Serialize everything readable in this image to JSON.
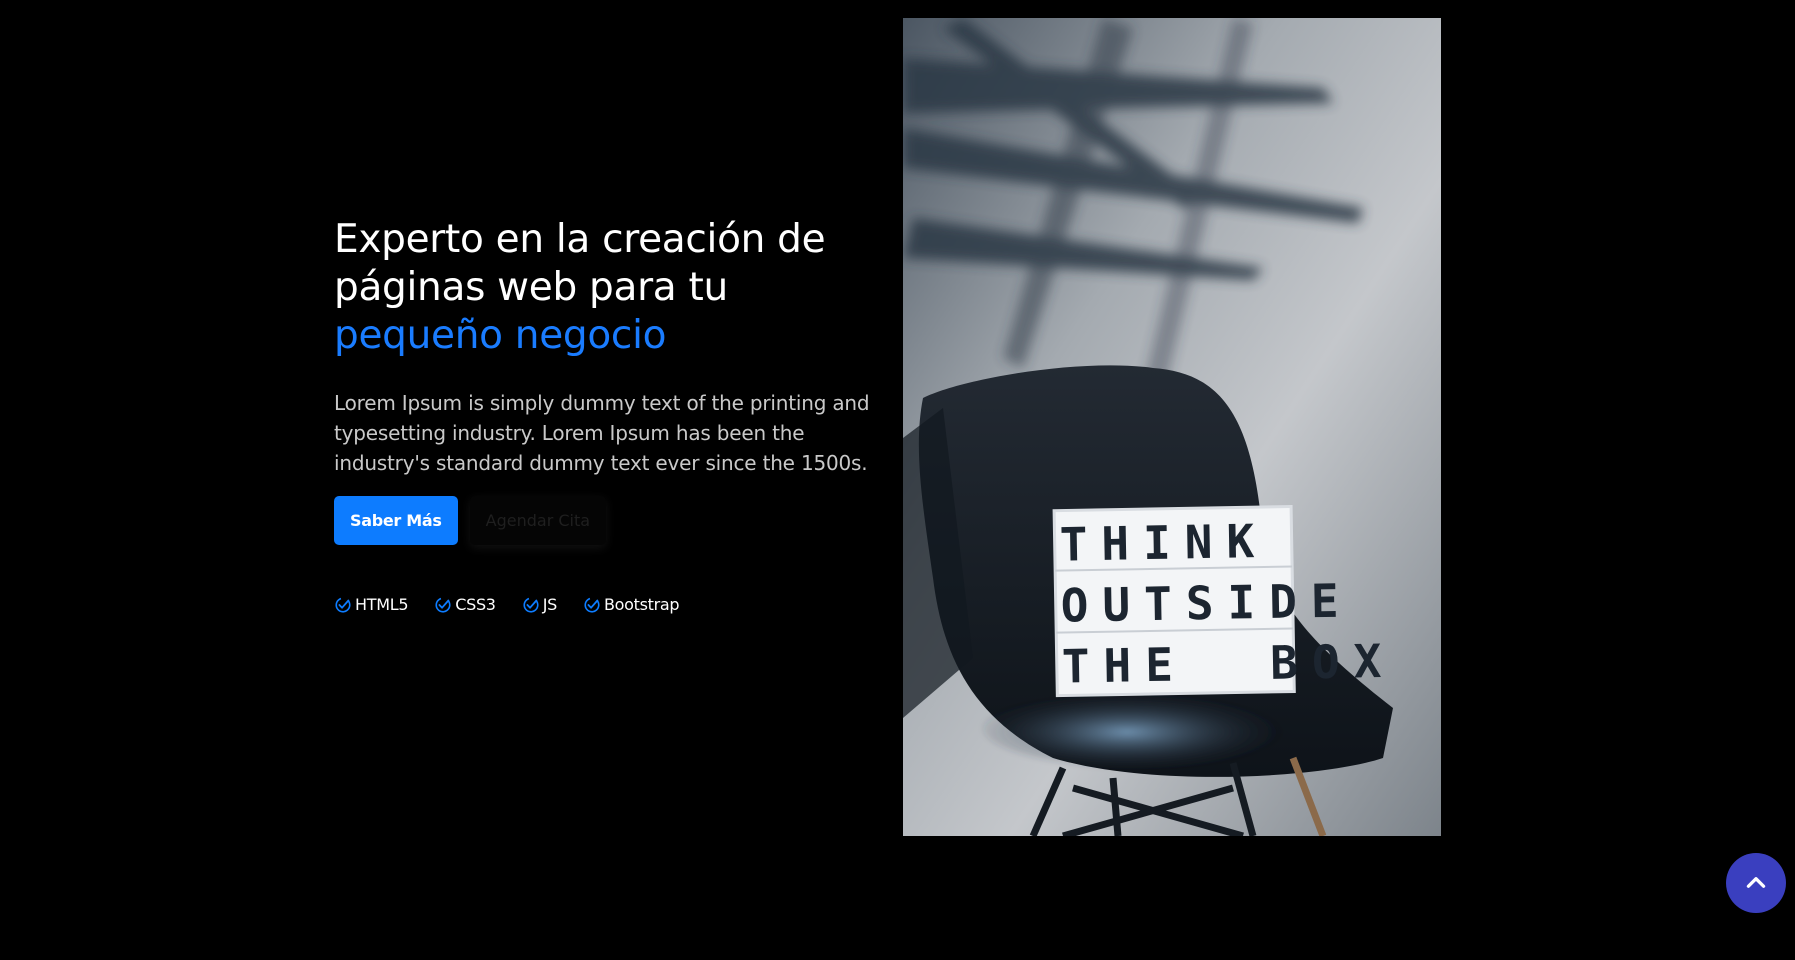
{
  "hero": {
    "headline_line1": "Experto en la creación de",
    "headline_line2": "páginas web para tu",
    "headline_accent": "pequeño negocio",
    "lead": "Lorem Ipsum is simply dummy text of the printing and typesetting industry. Lorem Ipsum has been the industry's standard dummy text ever since the 1500s.",
    "primary_button": "Saber Más",
    "secondary_button": "Agendar Cita"
  },
  "tech": [
    {
      "label": "HTML5",
      "icon": "check-circle-icon"
    },
    {
      "label": "CSS3",
      "icon": "check-circle-icon"
    },
    {
      "label": "JS",
      "icon": "check-circle-icon"
    },
    {
      "label": "Bootstrap",
      "icon": "check-circle-icon"
    }
  ],
  "image": {
    "lightbox_lines": [
      "THINK",
      "OUTSIDE",
      "THE  BOX"
    ]
  },
  "scroll_top": {
    "icon": "chevron-up-icon"
  },
  "colors": {
    "background": "#000000",
    "accent": "#0d7cff",
    "scroll_button": "#3a3fbf"
  }
}
